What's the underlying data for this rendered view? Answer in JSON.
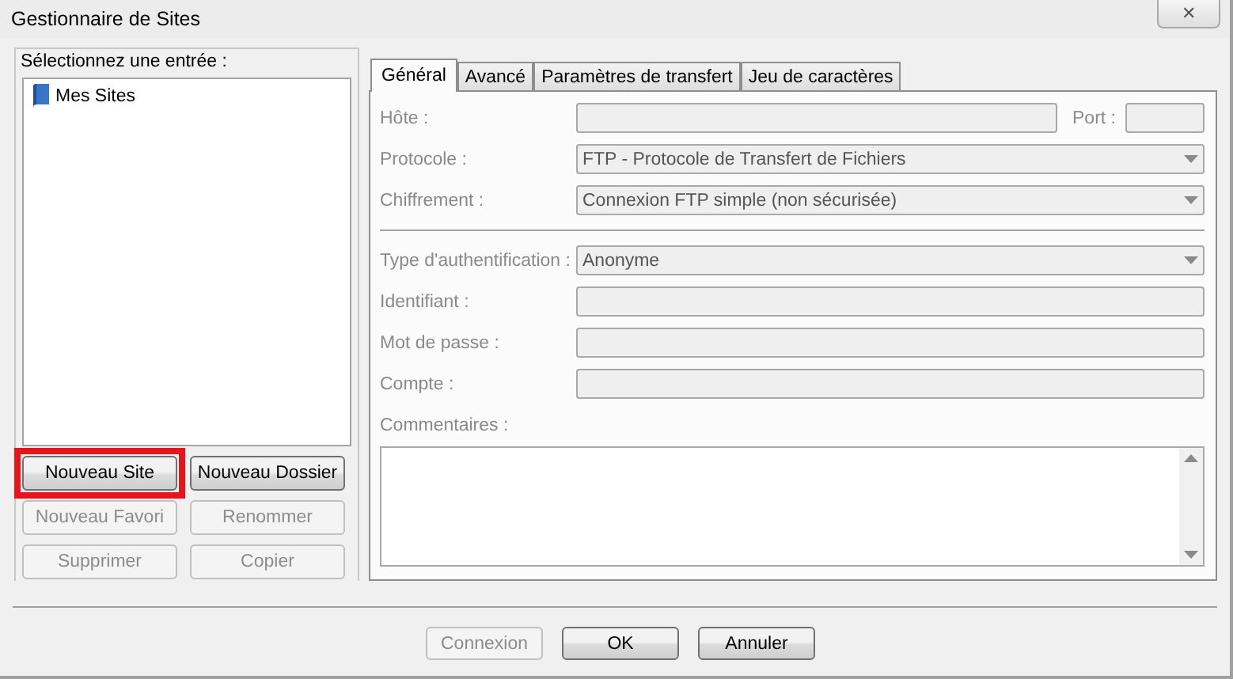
{
  "window": {
    "title": "Gestionnaire de Sites",
    "close_label": "✕"
  },
  "tree": {
    "label": "Sélectionnez une entrée :",
    "items": [
      {
        "label": "Mes Sites",
        "selected": false
      }
    ]
  },
  "left_buttons": [
    {
      "label": "Nouveau Site",
      "disabled": false,
      "highlighted": true
    },
    {
      "label": "Nouveau Dossier",
      "disabled": false,
      "highlighted": false
    },
    {
      "label": "Nouveau Favori",
      "disabled": true,
      "highlighted": false
    },
    {
      "label": "Renommer",
      "disabled": true,
      "highlighted": false
    },
    {
      "label": "Supprimer",
      "disabled": true,
      "highlighted": false
    },
    {
      "label": "Copier",
      "disabled": true,
      "highlighted": false
    }
  ],
  "tabs": [
    {
      "label": "Général",
      "selected": true
    },
    {
      "label": "Avancé",
      "selected": false
    },
    {
      "label": "Paramètres de transfert",
      "selected": false
    },
    {
      "label": "Jeu de caractères",
      "selected": false
    }
  ],
  "general": {
    "disabled": true,
    "connection_fields": [
      {
        "kind": "host",
        "label": "Hôte :",
        "port_label": "Port :"
      },
      {
        "kind": "select",
        "label": "Protocole :",
        "value": "FTP - Protocole de Transfert de Fichiers"
      },
      {
        "kind": "select",
        "label": "Chiffrement :",
        "value": "Connexion FTP simple (non sécurisée)"
      }
    ],
    "auth_fields": [
      {
        "kind": "select",
        "label": "Type d'authentification :",
        "value": "Anonyme"
      },
      {
        "kind": "text",
        "label": "Identifiant :"
      },
      {
        "kind": "text",
        "label": "Mot de passe :"
      },
      {
        "kind": "text",
        "label": "Compte :"
      }
    ],
    "comments_label": "Commentaires :"
  },
  "footer_buttons": [
    {
      "label": "Connexion",
      "disabled": true
    },
    {
      "label": "OK",
      "disabled": false
    },
    {
      "label": "Annuler",
      "disabled": false
    }
  ]
}
